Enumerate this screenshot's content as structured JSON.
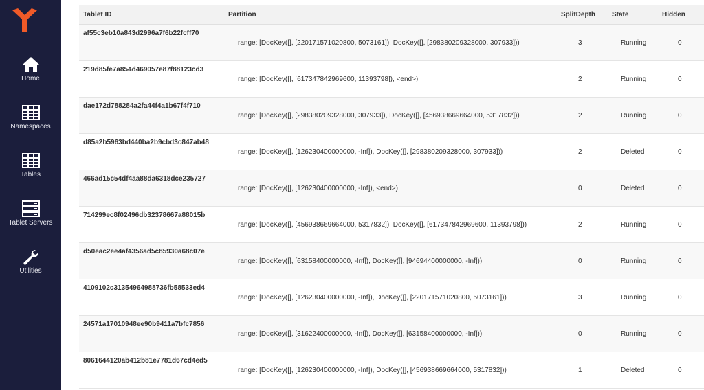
{
  "nav": [
    {
      "label": "Home",
      "icon": "home-icon"
    },
    {
      "label": "Namespaces",
      "icon": "table-icon"
    },
    {
      "label": "Tables",
      "icon": "table-icon"
    },
    {
      "label": "Tablet Servers",
      "icon": "server-icon"
    },
    {
      "label": "Utilities",
      "icon": "wrench-icon"
    }
  ],
  "colors": {
    "sidebar": "#1b1e3c",
    "logo": "#f05a28"
  },
  "table": {
    "headers": {
      "id": "Tablet ID",
      "partition": "Partition",
      "split": "SplitDepth",
      "state": "State",
      "hidden": "Hidden"
    },
    "rows": [
      {
        "id": "af55c3eb10a843d2996a7f6b22fcff70",
        "partition": "range: [DocKey([], [220171571020800, 5073161]), DocKey([], [298380209328000, 307933]))",
        "split": "3",
        "state": "Running",
        "hidden": "0"
      },
      {
        "id": "219d85fe7a854d469057e87f88123cd3",
        "partition": "range: [DocKey([], [617347842969600, 11393798]), <end>)",
        "split": "2",
        "state": "Running",
        "hidden": "0"
      },
      {
        "id": "dae172d788284a2fa44f4a1b67f4f710",
        "partition": "range: [DocKey([], [298380209328000, 307933]), DocKey([], [456938669664000, 5317832]))",
        "split": "2",
        "state": "Running",
        "hidden": "0"
      },
      {
        "id": "d85a2b5963bd440ba2b9cbd3c847ab48",
        "partition": "range: [DocKey([], [126230400000000, -Inf]), DocKey([], [298380209328000, 307933]))",
        "split": "2",
        "state": "Deleted",
        "hidden": "0"
      },
      {
        "id": "466ad15c54df4aa88da6318dce235727",
        "partition": "range: [DocKey([], [126230400000000, -Inf]), <end>)",
        "split": "0",
        "state": "Deleted",
        "hidden": "0"
      },
      {
        "id": "714299ec8f02496db32378667a88015b",
        "partition": "range: [DocKey([], [456938669664000, 5317832]), DocKey([], [617347842969600, 11393798]))",
        "split": "2",
        "state": "Running",
        "hidden": "0"
      },
      {
        "id": "d50eac2ee4af4356ad5c85930a68c07e",
        "partition": "range: [DocKey([], [63158400000000, -Inf]), DocKey([], [94694400000000, -Inf]))",
        "split": "0",
        "state": "Running",
        "hidden": "0"
      },
      {
        "id": "4109102c31354964988736fb58533ed4",
        "partition": "range: [DocKey([], [126230400000000, -Inf]), DocKey([], [220171571020800, 5073161]))",
        "split": "3",
        "state": "Running",
        "hidden": "0"
      },
      {
        "id": "24571a17010948ee90b9411a7bfc7856",
        "partition": "range: [DocKey([], [31622400000000, -Inf]), DocKey([], [63158400000000, -Inf]))",
        "split": "0",
        "state": "Running",
        "hidden": "0"
      },
      {
        "id": "8061644120ab412b81e7781d67cd4ed5",
        "partition": "range: [DocKey([], [126230400000000, -Inf]), DocKey([], [456938669664000, 5317832]))",
        "split": "1",
        "state": "Deleted",
        "hidden": "0"
      }
    ]
  }
}
